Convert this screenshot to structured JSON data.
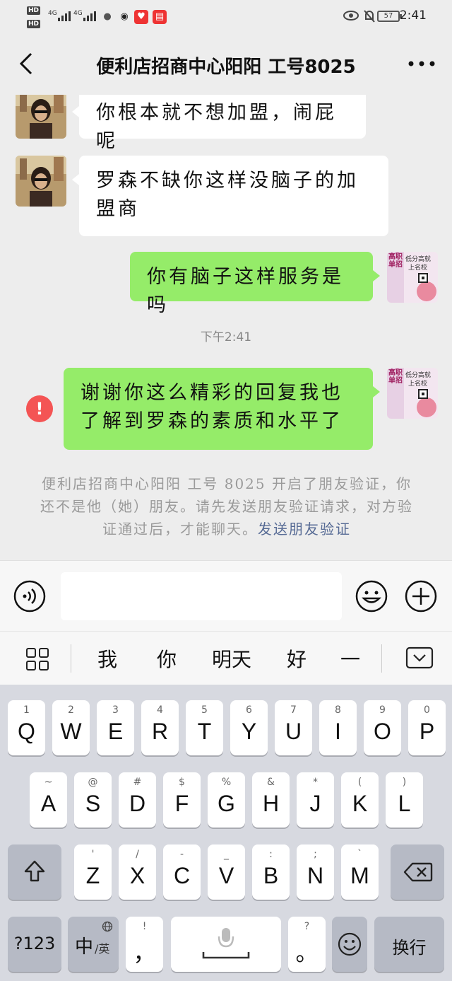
{
  "status_bar": {
    "hd1": "HD",
    "hd2": "HD",
    "sig1": "4G",
    "sig2": "4G",
    "battery": "57",
    "time": "2:41"
  },
  "nav": {
    "title": "便利店招商中心阳阳 工号8025",
    "back_icon": "chevron-left-icon",
    "more_icon": "more-dots-icon"
  },
  "messages": [
    {
      "side": "in",
      "text": "你根本就不想加盟，闹屁呢"
    },
    {
      "side": "in",
      "text": "罗森不缺你这样没脑子的加盟商"
    },
    {
      "side": "out",
      "text": "你有脑子这样服务是吗"
    },
    {
      "side": "out",
      "text": "谢谢你这么精彩的回复我也了解到罗森的素质和水平了",
      "failed": true
    }
  ],
  "timestamp": "下午2:41",
  "avatar_out": {
    "line1": "高职单招",
    "line2": "低分高就",
    "line3": "上名校"
  },
  "system_note": {
    "text": "便利店招商中心阳阳 工号 8025 开启了朋友验证，你还不是他（她）朋友。请先发送朋友验证请求，对方验证通过后，才能聊天。",
    "link": "发送朋友验证"
  },
  "error_mark": "!",
  "suggestions": [
    "我",
    "你",
    "明天",
    "好",
    "一"
  ],
  "keyboard": {
    "row1": [
      {
        "hint": "1",
        "key": "Q"
      },
      {
        "hint": "2",
        "key": "W"
      },
      {
        "hint": "3",
        "key": "E"
      },
      {
        "hint": "4",
        "key": "R"
      },
      {
        "hint": "5",
        "key": "T"
      },
      {
        "hint": "6",
        "key": "Y"
      },
      {
        "hint": "7",
        "key": "U"
      },
      {
        "hint": "8",
        "key": "I"
      },
      {
        "hint": "9",
        "key": "O"
      },
      {
        "hint": "0",
        "key": "P"
      }
    ],
    "row2": [
      {
        "hint": "~",
        "key": "A"
      },
      {
        "hint": "@",
        "key": "S"
      },
      {
        "hint": "#",
        "key": "D"
      },
      {
        "hint": "$",
        "key": "F"
      },
      {
        "hint": "%",
        "key": "G"
      },
      {
        "hint": "&",
        "key": "H"
      },
      {
        "hint": "*",
        "key": "J"
      },
      {
        "hint": "(",
        "key": "K"
      },
      {
        "hint": ")",
        "key": "L"
      }
    ],
    "row3": [
      {
        "hint": "'",
        "key": "Z"
      },
      {
        "hint": "/",
        "key": "X"
      },
      {
        "hint": "-",
        "key": "C"
      },
      {
        "hint": "_",
        "key": "V"
      },
      {
        "hint": ":",
        "key": "B"
      },
      {
        "hint": ";",
        "key": "N"
      },
      {
        "hint": "`",
        "key": "M"
      }
    ],
    "num_key": "?123",
    "lang_key": "中",
    "lang_sub": "/英",
    "comma_hint": "!",
    "comma_key": "，",
    "period_hint": "?",
    "period_key": "。",
    "enter_key": "换行"
  }
}
